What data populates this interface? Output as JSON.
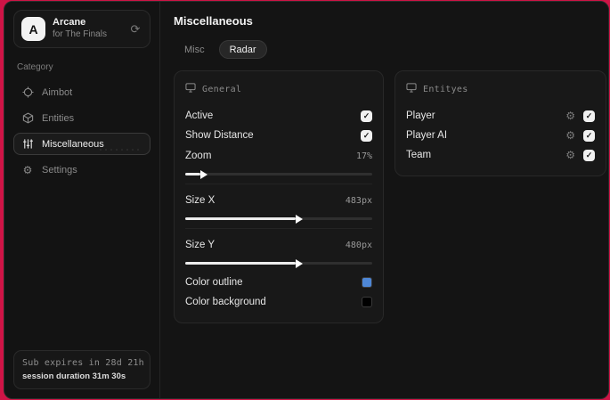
{
  "colors": {
    "backdrop_red": "#cf1446",
    "window_bg": "#131313",
    "panel_bg": "#181818",
    "outline_swatch": "#4e87d6",
    "background_swatch": "#000000"
  },
  "icons": {
    "sync_glyph": "⟳",
    "gear_glyph": "⚙"
  },
  "sidebar": {
    "brand": {
      "logo_letter": "A",
      "name": "Arcane",
      "subtitle": "for The Finals"
    },
    "category_label": "Category",
    "items": [
      {
        "label": "Aimbot",
        "icon": "crosshair-icon",
        "selected": false
      },
      {
        "label": "Entities",
        "icon": "cube-icon",
        "selected": false
      },
      {
        "label": "Miscellaneous",
        "icon": "sliders-icon",
        "selected": true
      },
      {
        "label": "Settings",
        "icon": "gear-icon",
        "selected": false
      }
    ],
    "subscription": {
      "expires": "Sub expires in 28d 21h",
      "session": "session duration 31m 30s"
    }
  },
  "main": {
    "title": "Miscellaneous",
    "tabs": [
      {
        "label": "Misc",
        "selected": false
      },
      {
        "label": "Radar",
        "selected": true
      }
    ],
    "general_panel": {
      "title": "General",
      "toggles": [
        {
          "label": "Active",
          "checked": true
        },
        {
          "label": "Show Distance",
          "checked": true
        }
      ],
      "sliders": [
        {
          "label": "Zoom",
          "value": "17%",
          "fraction": 0.08
        },
        {
          "label": "Size X",
          "value": "483px",
          "fraction": 0.59
        },
        {
          "label": "Size Y",
          "value": "480px",
          "fraction": 0.59
        }
      ],
      "color_rows": [
        {
          "label": "Color outline",
          "hex": "#4e87d6"
        },
        {
          "label": "Color background",
          "hex": "#000000"
        }
      ]
    },
    "entities_panel": {
      "title": "Entityes",
      "rows": [
        {
          "label": "Player",
          "checked": true
        },
        {
          "label": "Player AI",
          "checked": true
        },
        {
          "label": "Team",
          "checked": true
        }
      ]
    }
  }
}
